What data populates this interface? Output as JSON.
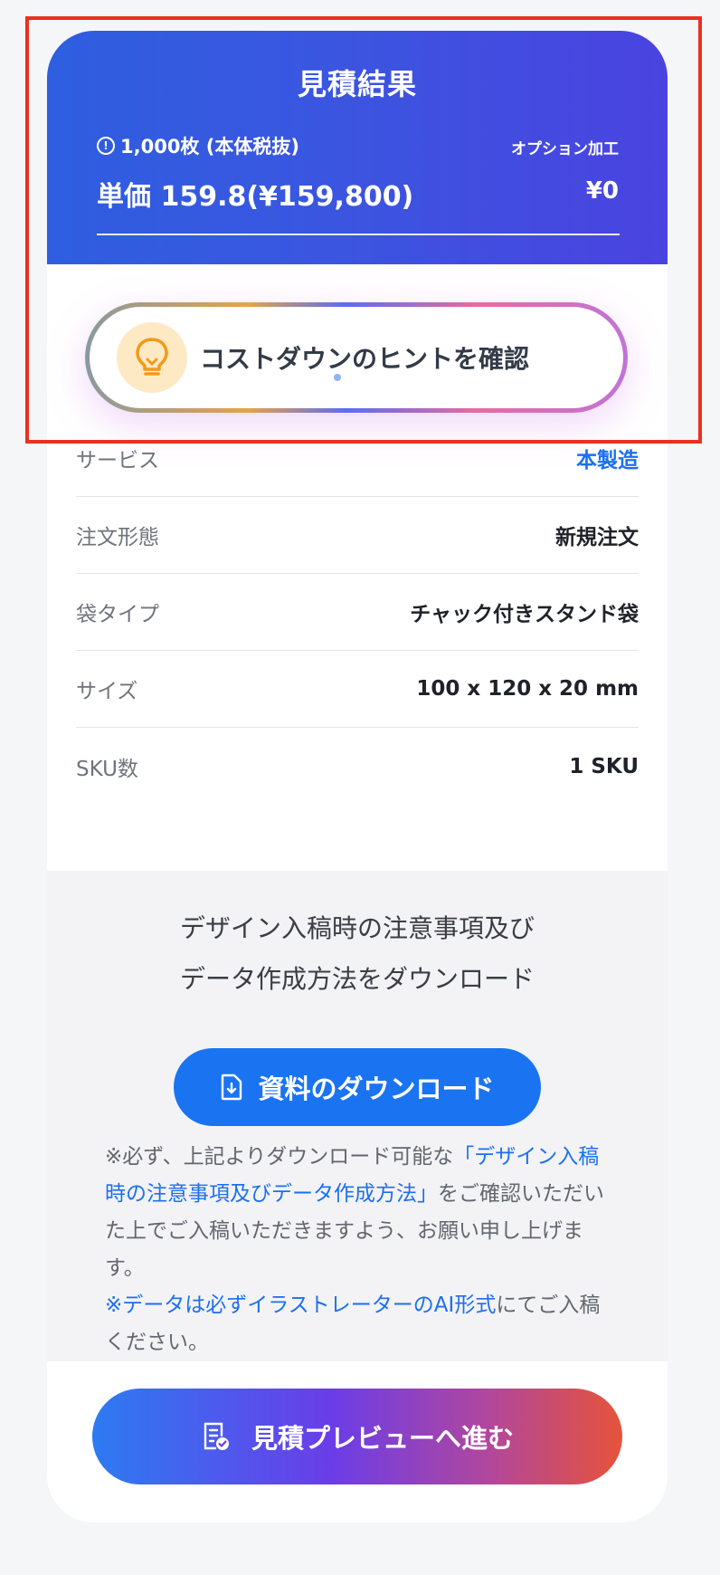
{
  "header": {
    "title": "見積結果",
    "quantity_text": "1,000枚 (本体税抜)",
    "option_label": "オプション加工",
    "unit_price": "単価 159.8(¥159,800)",
    "option_price": "¥0"
  },
  "hint": {
    "label": "コストダウンのヒントを確認",
    "icon": "lightbulb-icon"
  },
  "details": [
    {
      "label": "サービス",
      "value": "本製造"
    },
    {
      "label": "注文形態",
      "value": "新規注文"
    },
    {
      "label": "袋タイプ",
      "value": "チャック付きスタンド袋"
    },
    {
      "label": "サイズ",
      "value": "100 x 120 x 20 mm"
    },
    {
      "label": "SKU数",
      "value": "1 SKU"
    }
  ],
  "download": {
    "title_line1": "デザイン入稿時の注意事項及び",
    "title_line2": "データ作成方法をダウンロード",
    "button_label": "資料のダウンロード",
    "note_prefix": "※必ず、上記よりダウンロード可能な",
    "note_link": "「デザイン入稿時の注意事項及びデータ作成方法」",
    "note_suffix": "をご確認いただいた上でご入稿いただきますよう、お願い申し上げます。",
    "note2_link": "※データは必ずイラストレーターのAI形式",
    "note2_suffix": "にてご入稿ください。"
  },
  "preview": {
    "button_label": "見積プレビューへ進む"
  },
  "colors": {
    "header_blue": "#3a56e0",
    "link_blue": "#1c6ff0",
    "download_button": "#1a74f2",
    "highlight_red": "#e8321e"
  }
}
